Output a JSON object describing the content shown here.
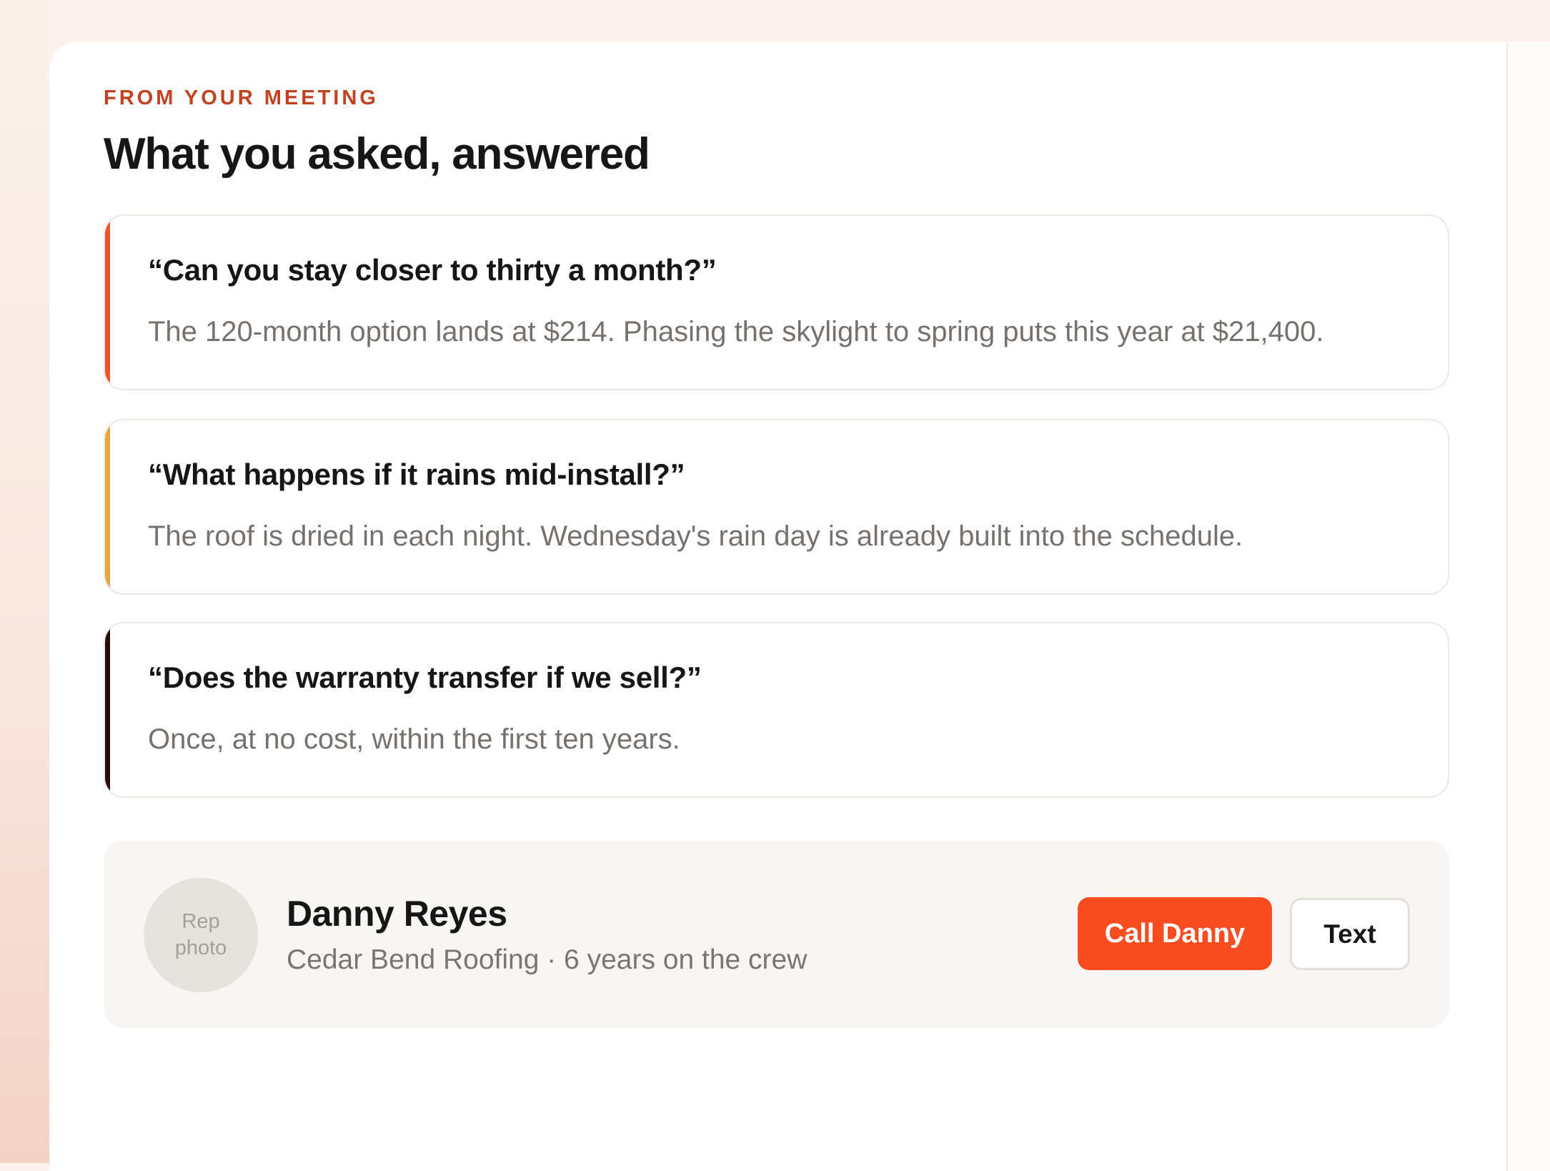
{
  "section": {
    "eyebrow": "FROM YOUR MEETING",
    "title": "What you asked, answered"
  },
  "qa_items": [
    {
      "question": "“Can you stay closer to thirty a month?”",
      "answer": "The 120-month option lands at $214. Phasing the skylight to spring puts this year at $21,400.",
      "accent_color": "#f0522a"
    },
    {
      "question": "“What happens if it rains mid-install?”",
      "answer": "The roof is dried in each night. Wednesday's rain day is already built into the schedule.",
      "accent_color": "#e3a83e"
    },
    {
      "question": "“Does the warranty transfer if we sell?”",
      "answer": "Once, at no cost, within the first ten years.",
      "accent_color": "#2a0c08"
    }
  ],
  "rep": {
    "photo_placeholder_line1": "Rep",
    "photo_placeholder_line2": "photo",
    "name": "Danny Reyes",
    "subtitle": "Cedar Bend Roofing · 6 years on the crew",
    "call_label": "Call Danny",
    "text_label": "Text"
  },
  "colors": {
    "accent": "#fa4c21",
    "eyebrow": "#c2411f"
  }
}
